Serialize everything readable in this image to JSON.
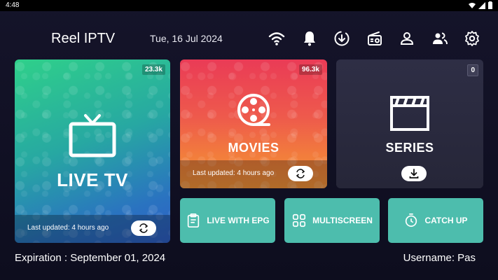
{
  "status_bar": {
    "time": "4:48"
  },
  "header": {
    "app_title": "Reel IPTV",
    "date": "Tue, 16 Jul 2024",
    "icons": [
      "wifi-icon",
      "bell-icon",
      "download-icon",
      "radio-icon",
      "user-icon",
      "users-icon",
      "gear-icon"
    ]
  },
  "cards": {
    "live_tv": {
      "label": "LIVE TV",
      "count": "23.3k",
      "updated": "Last updated: 4 hours ago"
    },
    "movies": {
      "label": "MOVIES",
      "count": "96.3k",
      "updated": "Last updated: 4 hours ago"
    },
    "series": {
      "label": "SERIES",
      "count": "0"
    }
  },
  "features": {
    "live_epg": "LIVE WITH EPG",
    "multiscreen": "MULTISCREEN",
    "catch_up": "CATCH UP"
  },
  "footer": {
    "expiration": "Expiration :  September 01, 2024",
    "username": "Username: Pas"
  },
  "colors": {
    "accent_teal": "#4dbdad",
    "live_gradient_start": "#2fd08a",
    "live_gradient_end": "#2f5fc7",
    "movies_gradient_start": "#ea3b56",
    "movies_gradient_end": "#f5953a",
    "series_bg": "#2e2e45",
    "background": "#15142a"
  }
}
